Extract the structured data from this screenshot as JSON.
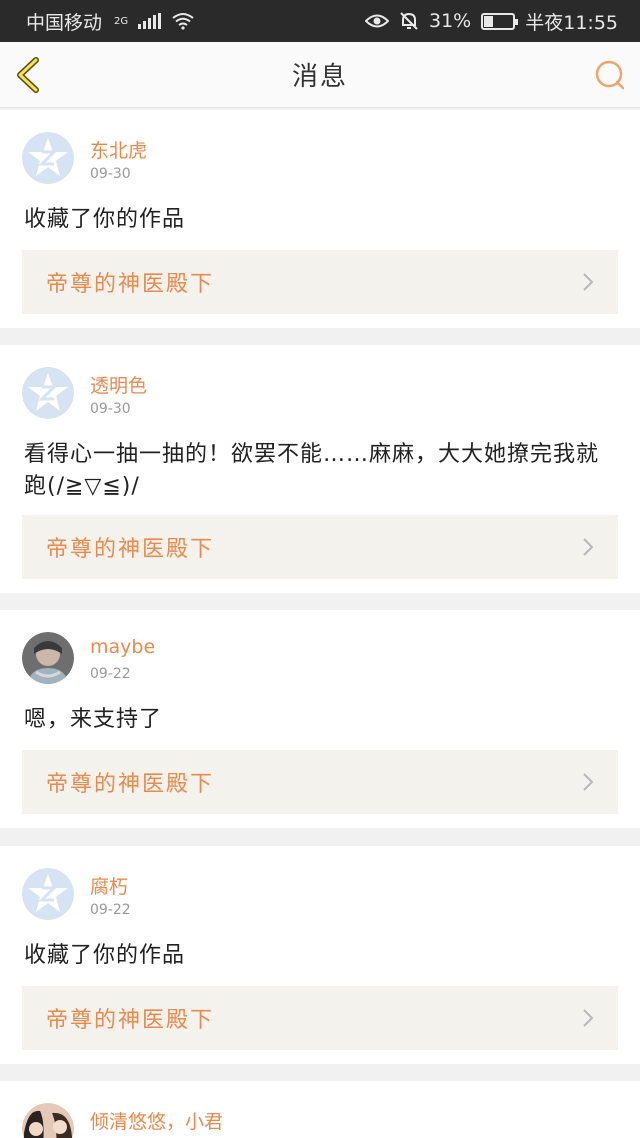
{
  "status_bar": {
    "carrier": "中国移动",
    "network": "2G",
    "battery_percent": "31%",
    "battery_level": 0.31,
    "time": "半夜11:55"
  },
  "header": {
    "title": "消息"
  },
  "messages": [
    {
      "username": "东北虎",
      "date": "09-30",
      "text": "收藏了你的作品",
      "work_title": "帝尊的神医殿下",
      "avatar": "default-avatar-icon"
    },
    {
      "username": "透明色",
      "date": "09-30",
      "text": "看得心一抽一抽的！欲罢不能……麻麻，大大她撩完我就跑(/≧▽≦)/",
      "work_title": "帝尊的神医殿下",
      "avatar": "default-avatar-icon"
    },
    {
      "username": "maybe",
      "date": "09-22",
      "text": "嗯，来支持了",
      "work_title": "帝尊的神医殿下",
      "avatar": "photo-avatar"
    },
    {
      "username": "腐朽",
      "date": "09-22",
      "text": "收藏了你的作品",
      "work_title": "帝尊的神医殿下",
      "avatar": "default-avatar-icon"
    },
    {
      "username": "倾清悠悠，小君",
      "avatar": "photo-avatar"
    }
  ],
  "colors": {
    "accent": "#ec8a4d",
    "link_bg": "#f3f2ec",
    "status_bar_bg": "#2a2a2a",
    "default_avatar": "#d5e3f2"
  }
}
